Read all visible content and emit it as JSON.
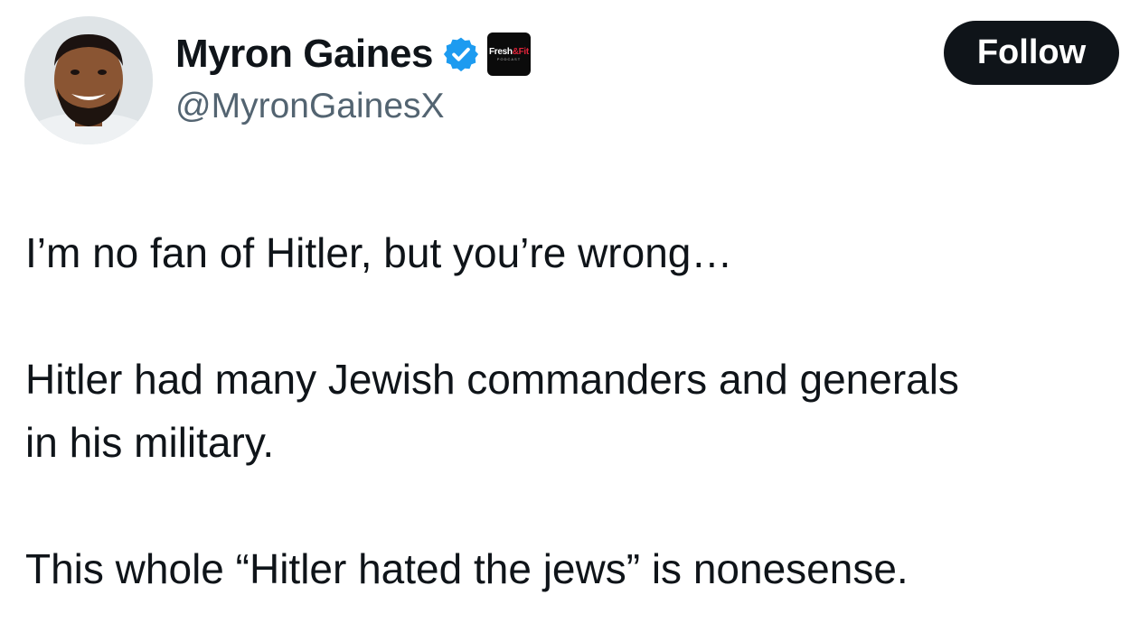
{
  "author": {
    "display_name": "Myron Gaines",
    "handle": "@MyronGainesX",
    "verified_icon": "verified-badge-icon",
    "affiliate_badge": {
      "text_main": "Fresh",
      "text_accent": "&Fit",
      "text_sub": "PODCAST"
    }
  },
  "actions": {
    "follow_label": "Follow"
  },
  "tweet": {
    "paragraph1": "I’m no fan of Hitler, but you’re wrong…",
    "paragraph2": "Hitler had many Jewish commanders and generals\nin his military.",
    "paragraph3": "This whole “Hitler hated the jews” is nonesense."
  },
  "colors": {
    "text_primary": "#0f1419",
    "text_secondary": "#536471",
    "verified_blue": "#1d9bf0",
    "follow_button_bg": "#0f1419",
    "badge_accent_red": "#e0243a"
  }
}
